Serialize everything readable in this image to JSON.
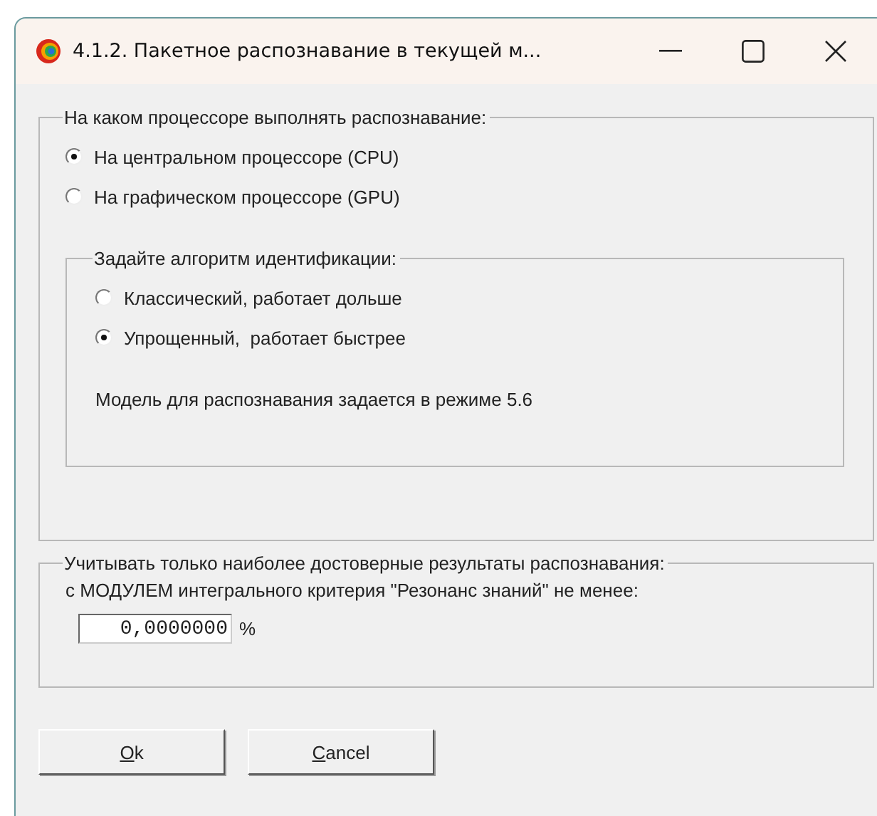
{
  "window": {
    "title": "4.1.2. Пакетное распознавание в текущей м..."
  },
  "processor_group": {
    "legend": "На каком процессоре выполнять распознавание:",
    "options": [
      {
        "label": "На центральном процессоре (CPU)",
        "selected": true
      },
      {
        "label": "На графическом процессоре (GPU)",
        "selected": false
      }
    ],
    "algorithm_group": {
      "legend": "Задайте алгоритм идентификации:",
      "options": [
        {
          "label": "Классический, работает дольше",
          "selected": false
        },
        {
          "label": "Упрощенный,  работает быстрее",
          "selected": true
        }
      ],
      "note": "Модель для распознавания задается в режиме 5.6"
    }
  },
  "threshold_group": {
    "legend": "Учитывать только наиболее достоверные результаты распознавания:",
    "caption": "с МОДУЛЕМ интегрального критерия \"Резонанс знаний\" не менее:",
    "value": "0,0000000",
    "unit": "%"
  },
  "buttons": [
    {
      "label": "Ok"
    },
    {
      "label": "Cancel"
    }
  ]
}
